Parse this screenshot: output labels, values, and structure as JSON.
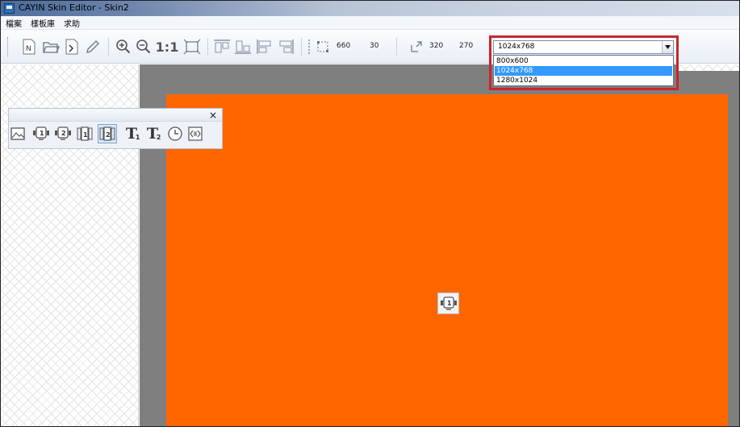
{
  "window": {
    "title": "CAYIN Skin Editor - Skin2"
  },
  "menu": {
    "items": [
      {
        "label": "檔案"
      },
      {
        "label": "樣板庫"
      },
      {
        "label": "求助"
      }
    ]
  },
  "toolbar": {
    "new_label": "N",
    "zoom_actual_label": "1:1",
    "size_width": "660",
    "size_height": "30",
    "pos_x": "320",
    "pos_y": "270"
  },
  "resolution": {
    "selected": "1024x768",
    "options": [
      "800x600",
      "1024x768",
      "1280x1024"
    ],
    "highlight_color": "#c8262e"
  },
  "palette": {
    "close_label": "×",
    "text1_label": "T",
    "text1_sub": "1",
    "text2_label": "T",
    "text2_sub": "2"
  },
  "stage": {
    "background_color": "#ff6600"
  }
}
